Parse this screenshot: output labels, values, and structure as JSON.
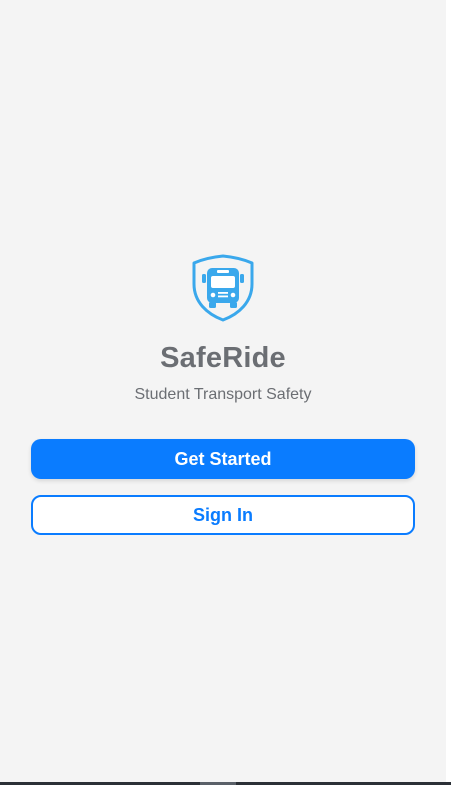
{
  "app": {
    "title": "SafeRide",
    "subtitle": "Student Transport Safety",
    "logo_icon": "shield-bus-icon"
  },
  "actions": {
    "get_started_label": "Get Started",
    "sign_in_label": "Sign In"
  },
  "colors": {
    "accent": "#0a7cff",
    "logo": "#3aa8ec",
    "background": "#f4f4f4",
    "text_muted": "#6b6e73"
  }
}
